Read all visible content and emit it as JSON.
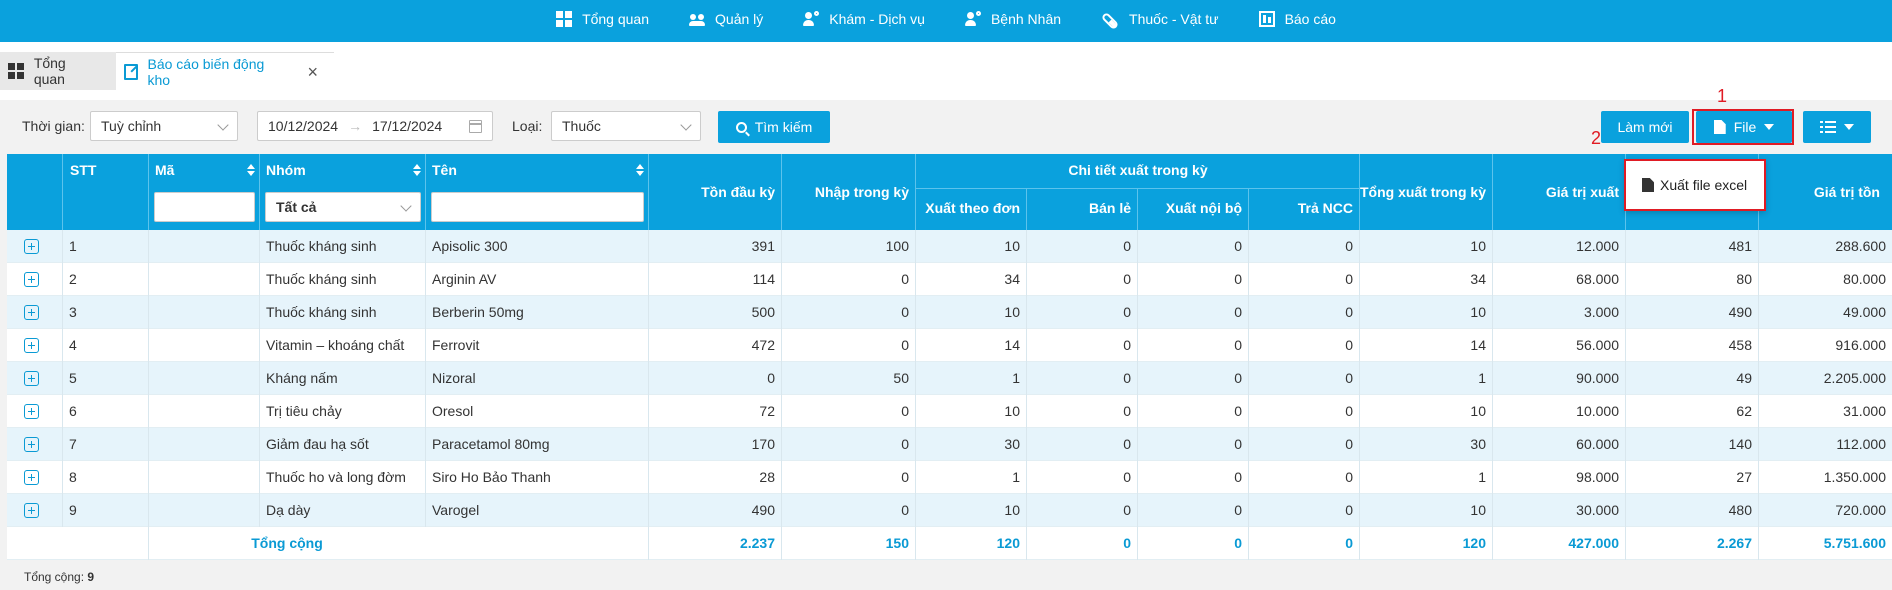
{
  "topnav": {
    "items": [
      {
        "label": "Tổng quan",
        "icon": "dashboard-icon"
      },
      {
        "label": "Quản lý",
        "icon": "users-icon"
      },
      {
        "label": "Khám - Dịch vụ",
        "icon": "doctor-icon"
      },
      {
        "label": "Bệnh Nhân",
        "icon": "patient-icon"
      },
      {
        "label": "Thuốc - Vật tư",
        "icon": "pill-icon"
      },
      {
        "label": "Báo cáo",
        "icon": "report-icon"
      }
    ]
  },
  "tabs": [
    {
      "label": "Tổng quan"
    },
    {
      "label": "Báo cáo biến động kho",
      "close": "×"
    }
  ],
  "filters": {
    "time_label": "Thời gian:",
    "time_value": "Tuỳ chỉnh",
    "date_from": "10/12/2024",
    "date_arrow": "→",
    "date_to": "17/12/2024",
    "type_label": "Loại:",
    "type_value": "Thuốc",
    "search_button": "Tìm kiếm",
    "refresh_button": "Làm mới",
    "file_button": "File"
  },
  "annotations": {
    "one": "1",
    "two": "2"
  },
  "dropdown": {
    "item": "Xuất file excel"
  },
  "table": {
    "headers": {
      "stt": "STT",
      "ma": "Mã",
      "nhom": "Nhóm",
      "ten": "Tên",
      "ton_dau": "Tồn đầu kỳ",
      "nhap": "Nhập trong kỳ",
      "chi_tiet": "Chi tiết xuất trong kỳ",
      "xuat_theo_don": "Xuất theo đơn",
      "ban_le": "Bán lẻ",
      "xuat_noi_bo": "Xuất nội bộ",
      "tra_ncc": "Trả NCC",
      "tong_xuat": "Tổng xuất trong kỳ",
      "gia_tri_xuat": "Giá trị xuất",
      "gia_tri_ton": "Giá trị tồn"
    },
    "nhom_filter": "Tất cả",
    "rows": [
      {
        "stt": "1",
        "nhom": "Thuốc kháng sinh",
        "ten": "Apisolic 300",
        "ton_dau": "391",
        "nhap": "100",
        "xtd": "10",
        "ban_le": "0",
        "xnb": "0",
        "tra": "0",
        "tong": "10",
        "gtx": "12.000",
        "ton_cuoi": "481",
        "gtt": "288.600"
      },
      {
        "stt": "2",
        "nhom": "Thuốc kháng sinh",
        "ten": "Arginin AV",
        "ton_dau": "114",
        "nhap": "0",
        "xtd": "34",
        "ban_le": "0",
        "xnb": "0",
        "tra": "0",
        "tong": "34",
        "gtx": "68.000",
        "ton_cuoi": "80",
        "gtt": "80.000"
      },
      {
        "stt": "3",
        "nhom": "Thuốc kháng sinh",
        "ten": "Berberin 50mg",
        "ton_dau": "500",
        "nhap": "0",
        "xtd": "10",
        "ban_le": "0",
        "xnb": "0",
        "tra": "0",
        "tong": "10",
        "gtx": "3.000",
        "ton_cuoi": "490",
        "gtt": "49.000"
      },
      {
        "stt": "4",
        "nhom": "Vitamin – khoáng chất",
        "ten": "Ferrovit",
        "ton_dau": "472",
        "nhap": "0",
        "xtd": "14",
        "ban_le": "0",
        "xnb": "0",
        "tra": "0",
        "tong": "14",
        "gtx": "56.000",
        "ton_cuoi": "458",
        "gtt": "916.000"
      },
      {
        "stt": "5",
        "nhom": "Kháng nấm",
        "ten": "Nizoral",
        "ton_dau": "0",
        "nhap": "50",
        "xtd": "1",
        "ban_le": "0",
        "xnb": "0",
        "tra": "0",
        "tong": "1",
        "gtx": "90.000",
        "ton_cuoi": "49",
        "gtt": "2.205.000"
      },
      {
        "stt": "6",
        "nhom": "Trị tiêu chảy",
        "ten": "Oresol",
        "ton_dau": "72",
        "nhap": "0",
        "xtd": "10",
        "ban_le": "0",
        "xnb": "0",
        "tra": "0",
        "tong": "10",
        "gtx": "10.000",
        "ton_cuoi": "62",
        "gtt": "31.000"
      },
      {
        "stt": "7",
        "nhom": "Giảm đau hạ sốt",
        "ten": "Paracetamol 80mg",
        "ton_dau": "170",
        "nhap": "0",
        "xtd": "30",
        "ban_le": "0",
        "xnb": "0",
        "tra": "0",
        "tong": "30",
        "gtx": "60.000",
        "ton_cuoi": "140",
        "gtt": "112.000"
      },
      {
        "stt": "8",
        "nhom": "Thuốc ho và long đờm",
        "ten": "Siro Ho Bảo Thanh",
        "ton_dau": "28",
        "nhap": "0",
        "xtd": "1",
        "ban_le": "0",
        "xnb": "0",
        "tra": "0",
        "tong": "1",
        "gtx": "98.000",
        "ton_cuoi": "27",
        "gtt": "1.350.000"
      },
      {
        "stt": "9",
        "nhom": "Dạ dày",
        "ten": "Varogel",
        "ton_dau": "490",
        "nhap": "0",
        "xtd": "10",
        "ban_le": "0",
        "xnb": "0",
        "tra": "0",
        "tong": "10",
        "gtx": "30.000",
        "ton_cuoi": "480",
        "gtt": "720.000"
      }
    ],
    "total": {
      "label": "Tổng cộng",
      "ton_dau": "2.237",
      "nhap": "150",
      "xtd": "120",
      "ban_le": "0",
      "xnb": "0",
      "tra": "0",
      "tong": "120",
      "gtx": "427.000",
      "ton_cuoi": "2.267",
      "gtt": "5.751.600"
    }
  },
  "footer": {
    "count_label": "Tổng cộng:",
    "count": "9"
  },
  "colors": {
    "primary": "#0aa1dd",
    "highlight": "#e01b24",
    "row_alt": "#e6f4fb"
  }
}
